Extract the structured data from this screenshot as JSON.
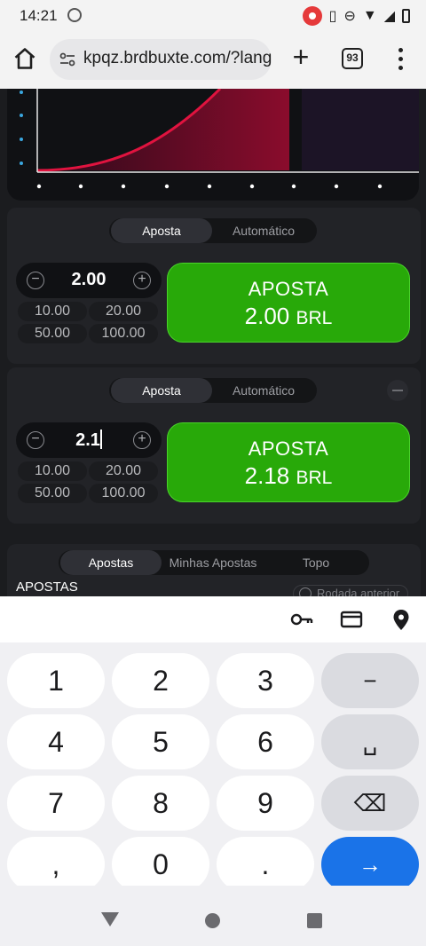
{
  "status": {
    "time": "14:21"
  },
  "browser": {
    "url": "kpqz.brdbuxte.com/?lang",
    "tab_count": "93"
  },
  "panel1": {
    "tab_bet": "Aposta",
    "tab_auto": "Automático",
    "amount": "2.00",
    "quick": [
      "10.00",
      "20.00",
      "50.00",
      "100.00"
    ],
    "button_line1": "APOSTA",
    "button_amount": "2.00",
    "button_currency": "BRL"
  },
  "panel2": {
    "tab_bet": "Aposta",
    "tab_auto": "Automático",
    "amount": "2.1",
    "quick": [
      "10.00",
      "20.00",
      "50.00",
      "100.00"
    ],
    "button_line1": "APOSTA",
    "button_amount": "2.18",
    "button_currency": "BRL"
  },
  "bets": {
    "tabs": [
      "Apostas",
      "Minhas Apostas",
      "Topo"
    ],
    "title": "APOSTAS",
    "prev_round": "Rodada anterior"
  },
  "keyboard": {
    "rows": [
      [
        "1",
        "2",
        "3",
        "−"
      ],
      [
        "4",
        "5",
        "6",
        "␣"
      ],
      [
        "7",
        "8",
        "9",
        "⌫"
      ],
      [
        ",",
        "0",
        ".",
        "→"
      ]
    ]
  },
  "colors": {
    "accent_green": "#28a909",
    "curve_red": "#e0133f",
    "key_blue": "#1a73e8"
  }
}
